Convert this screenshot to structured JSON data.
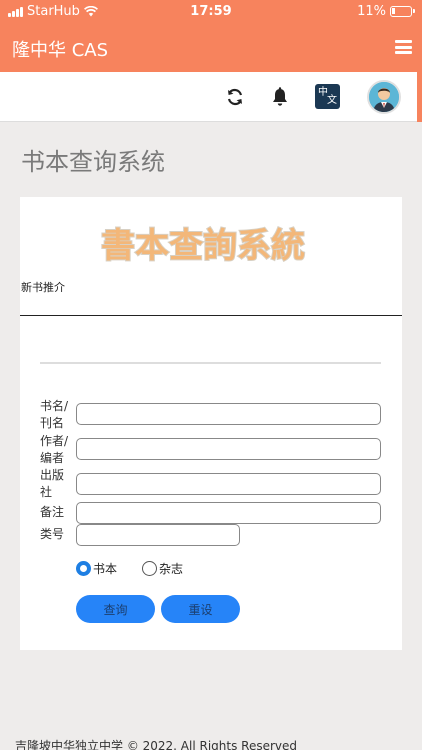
{
  "status_bar": {
    "carrier": "StarHub",
    "time": "17:59",
    "battery": "11%"
  },
  "navbar": {
    "brand": "隆中华 CAS"
  },
  "toolbar": {
    "refresh_icon": "refresh-icon",
    "bell_icon": "bell-icon",
    "language_icon": {
      "top": "中",
      "bottom": "文"
    },
    "avatar_icon": "user-avatar"
  },
  "page_title": "书本查询系统",
  "card": {
    "banner_text": "書本查詢系統",
    "new_books_label": "新书推介",
    "form": {
      "title_label": "书名/刊名",
      "title_value": "",
      "author_label": "作者/编者",
      "author_value": "",
      "publisher_label": "出版社",
      "publisher_value": "",
      "remarks_label": "备注",
      "remarks_value": "",
      "category_label": "类号",
      "category_value": "",
      "radio_book": "书本",
      "radio_magazine": "杂志",
      "selected_type": "书本"
    },
    "search_button": "查询",
    "reset_button": "重设"
  },
  "footer": "吉隆坡中华独立中学 © 2022. All Rights Reserved",
  "colors": {
    "accent": "#f7835d",
    "button": "#2684f8",
    "radio_selected": "#1e7fe3"
  }
}
